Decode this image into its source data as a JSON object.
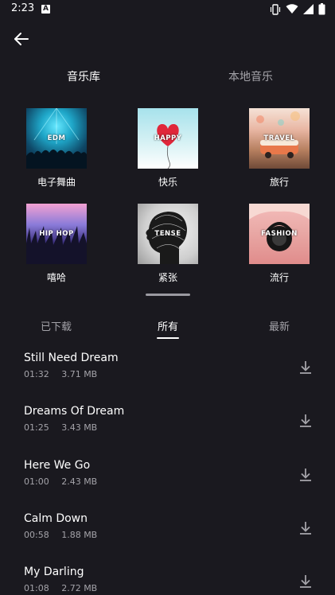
{
  "status_bar": {
    "time": "2:23",
    "notification_letter": "A"
  },
  "tabs": {
    "active": "音乐库",
    "inactive": "本地音乐"
  },
  "categories": [
    {
      "name": "电子舞曲",
      "thumb_text": "EDM",
      "theme": "edm"
    },
    {
      "name": "快乐",
      "thumb_text": "HAPPY",
      "theme": "happy"
    },
    {
      "name": "旅行",
      "thumb_text": "TRAVEL",
      "theme": "travel"
    },
    {
      "name": "嘻哈",
      "thumb_text": "HIP HOP",
      "theme": "hiphop"
    },
    {
      "name": "紧张",
      "thumb_text": "TENSE",
      "theme": "tense"
    },
    {
      "name": "流行",
      "thumb_text": "FASHION",
      "theme": "fashion"
    }
  ],
  "sub_tabs": {
    "downloaded": "已下载",
    "all": "所有",
    "latest": "最新",
    "active": "所有"
  },
  "tracks": [
    {
      "title": "Still Need Dream",
      "duration": "01:32",
      "size": "3.71 MB"
    },
    {
      "title": "Dreams Of Dream",
      "duration": "01:25",
      "size": "3.43 MB"
    },
    {
      "title": "Here We Go",
      "duration": "01:00",
      "size": "2.43 MB"
    },
    {
      "title": "Calm Down",
      "duration": "00:58",
      "size": "1.88 MB"
    },
    {
      "title": "My Darling",
      "duration": "01:08",
      "size": "2.72 MB"
    }
  ],
  "colors": {
    "background": "#1a191f",
    "text": "#ffffff",
    "muted": "#a4a3a9"
  },
  "icons": [
    "back-arrow-icon",
    "vibrate-icon",
    "wifi-icon",
    "signal-icon",
    "battery-icon",
    "download-icon"
  ]
}
